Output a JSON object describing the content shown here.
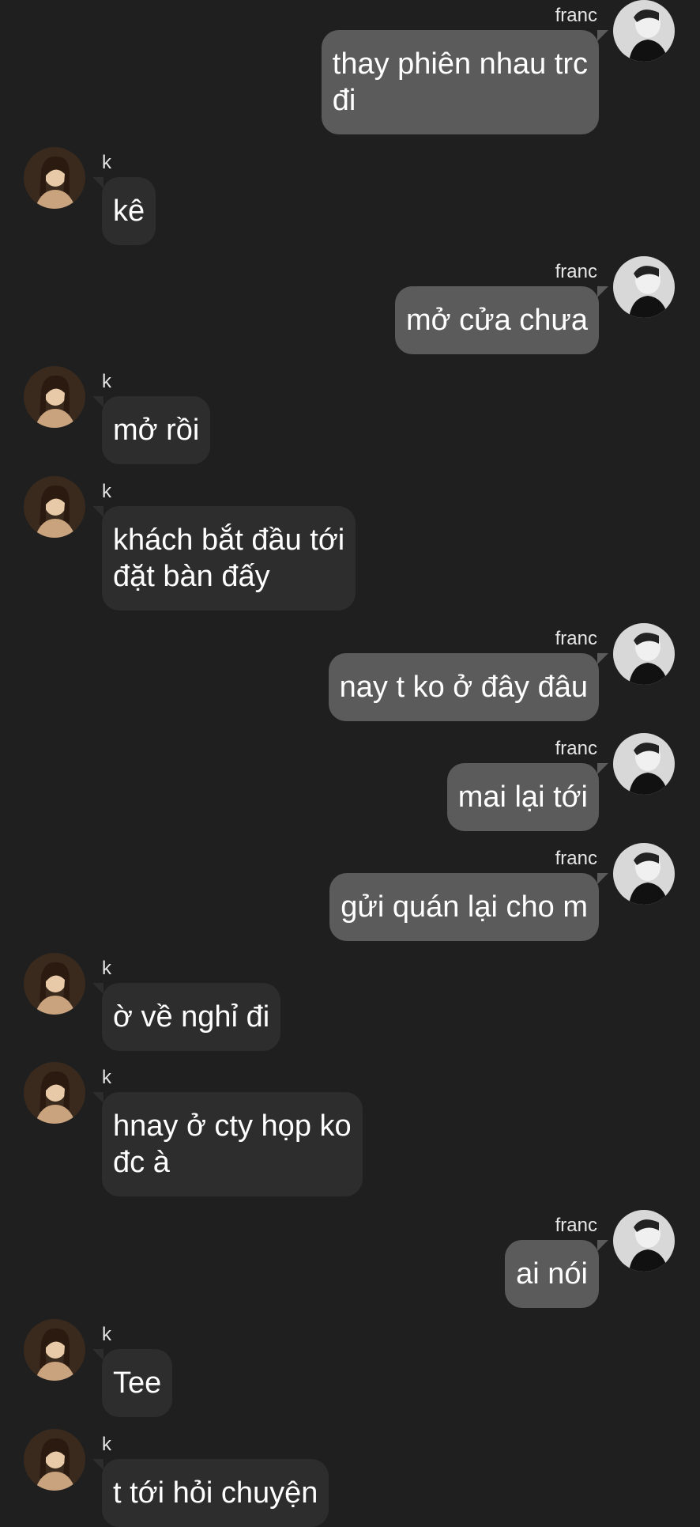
{
  "users": {
    "self": {
      "name": "franc",
      "avatar_icon": "user-avatar-franc-icon"
    },
    "other": {
      "name": "k",
      "avatar_icon": "user-avatar-k-icon"
    }
  },
  "colors": {
    "background": "#1f1f1f",
    "incoming_bubble": "#2d2d2d",
    "outgoing_bubble": "#5b5b5b",
    "text": "#ffffff"
  },
  "messages": [
    {
      "sender": "franc",
      "text": "thay phiên nhau trc\nđi"
    },
    {
      "sender": "k",
      "text": "kê"
    },
    {
      "sender": "franc",
      "text": "mở cửa chưa"
    },
    {
      "sender": "k",
      "text": "mở rồi"
    },
    {
      "sender": "k",
      "text": "khách bắt đầu tới\nđặt bàn đấy"
    },
    {
      "sender": "franc",
      "text": "nay t ko ở đây đâu"
    },
    {
      "sender": "franc",
      "text": "mai lại tới"
    },
    {
      "sender": "franc",
      "text": "gửi quán lại cho m"
    },
    {
      "sender": "k",
      "text": "ờ về nghỉ đi"
    },
    {
      "sender": "k",
      "text": "hnay ở cty họp ko\nđc à"
    },
    {
      "sender": "franc",
      "text": "ai nói"
    },
    {
      "sender": "k",
      "text": "Tee"
    },
    {
      "sender": "k",
      "text": "t tới hỏi chuyện"
    }
  ]
}
